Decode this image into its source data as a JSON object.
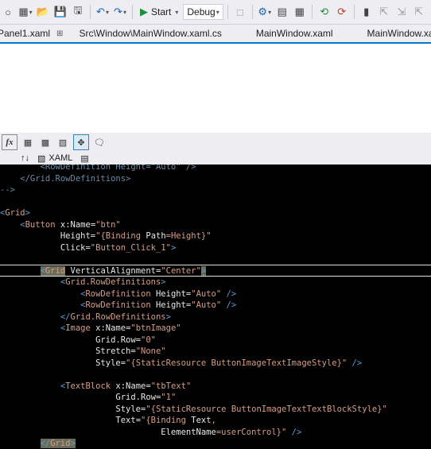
{
  "toolbar": {
    "start_label": "Start",
    "config_value": "Debug"
  },
  "tabs": [
    {
      "label": "Panel1.xaml"
    },
    {
      "label": "Src\\Window\\MainWindow.xaml.cs"
    },
    {
      "label": "MainWindow.xaml"
    },
    {
      "label": "MainWindow.xaml"
    }
  ],
  "designer": {
    "xaml_tab_label": "XAML",
    "swap_label": "↑↓"
  },
  "code": {
    "lines": [
      {
        "parts": [
          {
            "t": "        <RowDefinition Height=\"Auto\" />",
            "c": "c-dim"
          }
        ]
      },
      {
        "parts": [
          {
            "t": "    </Grid.RowDefinitions>",
            "c": "c-dim"
          }
        ]
      },
      {
        "parts": [
          {
            "t": "-->",
            "c": "c-dim"
          }
        ]
      },
      {
        "parts": [
          {
            "t": "",
            "c": "c-txt"
          }
        ]
      },
      {
        "parts": [
          {
            "t": "<",
            "c": "c-br"
          },
          {
            "t": "Grid",
            "c": "c-tag"
          },
          {
            "t": ">",
            "c": "c-br"
          }
        ]
      },
      {
        "parts": [
          {
            "t": "    <",
            "c": "c-br"
          },
          {
            "t": "Button",
            "c": "c-tag"
          },
          {
            "t": " x:Name",
            "c": "c-attr"
          },
          {
            "t": "=",
            "c": "c-eq"
          },
          {
            "t": "\"btn\"",
            "c": "c-str"
          }
        ]
      },
      {
        "parts": [
          {
            "t": "            Height",
            "c": "c-attr"
          },
          {
            "t": "=",
            "c": "c-eq"
          },
          {
            "t": "\"{",
            "c": "c-str"
          },
          {
            "t": "Binding",
            "c": "c-bind"
          },
          {
            "t": " Path",
            "c": "c-attr"
          },
          {
            "t": "=Height}\"",
            "c": "c-str"
          }
        ]
      },
      {
        "parts": [
          {
            "t": "            Click",
            "c": "c-attr"
          },
          {
            "t": "=",
            "c": "c-eq"
          },
          {
            "t": "\"Button_Click_1\"",
            "c": "c-str"
          },
          {
            "t": ">",
            "c": "c-br"
          }
        ]
      },
      {
        "parts": [
          {
            "t": "",
            "c": "c-txt"
          }
        ]
      },
      {
        "parts": [
          {
            "t": "        <",
            "c": "c-br"
          },
          {
            "t": "Grid",
            "c": "c-tag"
          },
          {
            "t": " VerticalAlignment",
            "c": "c-attr"
          },
          {
            "t": "=",
            "c": "c-eq"
          },
          {
            "t": "\"Center\"",
            "c": "c-str"
          },
          {
            "t": ">",
            "c": "c-br"
          }
        ]
      },
      {
        "parts": [
          {
            "t": "            <",
            "c": "c-br"
          },
          {
            "t": "Grid.RowDefinitions",
            "c": "c-tag"
          },
          {
            "t": ">",
            "c": "c-br"
          }
        ]
      },
      {
        "parts": [
          {
            "t": "                <",
            "c": "c-br"
          },
          {
            "t": "RowDefinition",
            "c": "c-tag"
          },
          {
            "t": " Height",
            "c": "c-attr"
          },
          {
            "t": "=",
            "c": "c-eq"
          },
          {
            "t": "\"Auto\"",
            "c": "c-str"
          },
          {
            "t": " />",
            "c": "c-br"
          }
        ]
      },
      {
        "parts": [
          {
            "t": "                <",
            "c": "c-br"
          },
          {
            "t": "RowDefinition",
            "c": "c-tag"
          },
          {
            "t": " Height",
            "c": "c-attr"
          },
          {
            "t": "=",
            "c": "c-eq"
          },
          {
            "t": "\"Auto\"",
            "c": "c-str"
          },
          {
            "t": " />",
            "c": "c-br"
          }
        ]
      },
      {
        "parts": [
          {
            "t": "            </",
            "c": "c-br"
          },
          {
            "t": "Grid.RowDefinitions",
            "c": "c-tag"
          },
          {
            "t": ">",
            "c": "c-br"
          }
        ]
      },
      {
        "parts": [
          {
            "t": "            <",
            "c": "c-br"
          },
          {
            "t": "Image",
            "c": "c-tag"
          },
          {
            "t": " x:Name",
            "c": "c-attr"
          },
          {
            "t": "=",
            "c": "c-eq"
          },
          {
            "t": "\"btnImage\"",
            "c": "c-str"
          }
        ]
      },
      {
        "parts": [
          {
            "t": "                   Grid.Row",
            "c": "c-attr"
          },
          {
            "t": "=",
            "c": "c-eq"
          },
          {
            "t": "\"0\"",
            "c": "c-str"
          }
        ]
      },
      {
        "parts": [
          {
            "t": "                   Stretch",
            "c": "c-attr"
          },
          {
            "t": "=",
            "c": "c-eq"
          },
          {
            "t": "\"None\"",
            "c": "c-str"
          }
        ]
      },
      {
        "parts": [
          {
            "t": "                   Style",
            "c": "c-attr"
          },
          {
            "t": "=",
            "c": "c-eq"
          },
          {
            "t": "\"{",
            "c": "c-str"
          },
          {
            "t": "StaticResource",
            "c": "c-bind"
          },
          {
            "t": " ButtonImageTextImageStyle}\"",
            "c": "c-str"
          },
          {
            "t": " />",
            "c": "c-br"
          }
        ]
      },
      {
        "parts": [
          {
            "t": "",
            "c": "c-txt"
          }
        ]
      },
      {
        "parts": [
          {
            "t": "            <",
            "c": "c-br"
          },
          {
            "t": "TextBlock",
            "c": "c-tag"
          },
          {
            "t": " x:Name",
            "c": "c-attr"
          },
          {
            "t": "=",
            "c": "c-eq"
          },
          {
            "t": "\"tbText\"",
            "c": "c-str"
          }
        ]
      },
      {
        "parts": [
          {
            "t": "                       Grid.Row",
            "c": "c-attr"
          },
          {
            "t": "=",
            "c": "c-eq"
          },
          {
            "t": "\"1\"",
            "c": "c-str"
          }
        ]
      },
      {
        "parts": [
          {
            "t": "                       Style",
            "c": "c-attr"
          },
          {
            "t": "=",
            "c": "c-eq"
          },
          {
            "t": "\"{",
            "c": "c-str"
          },
          {
            "t": "StaticResource",
            "c": "c-bind"
          },
          {
            "t": " ButtonImageTextTextBlockStyle}\"",
            "c": "c-str"
          }
        ]
      },
      {
        "parts": [
          {
            "t": "                       Text",
            "c": "c-attr"
          },
          {
            "t": "=",
            "c": "c-eq"
          },
          {
            "t": "\"{",
            "c": "c-str"
          },
          {
            "t": "Binding",
            "c": "c-bind"
          },
          {
            "t": " Text",
            "c": "c-attr"
          },
          {
            "t": ",",
            "c": "c-str"
          }
        ]
      },
      {
        "parts": [
          {
            "t": "                                ElementName",
            "c": "c-attr"
          },
          {
            "t": "=userControl}\"",
            "c": "c-str"
          },
          {
            "t": " />",
            "c": "c-br"
          }
        ]
      },
      {
        "parts": [
          {
            "t": "        </",
            "c": "c-br"
          },
          {
            "t": "Grid",
            "c": "c-tag"
          },
          {
            "t": ">",
            "c": "c-br"
          }
        ]
      }
    ]
  }
}
